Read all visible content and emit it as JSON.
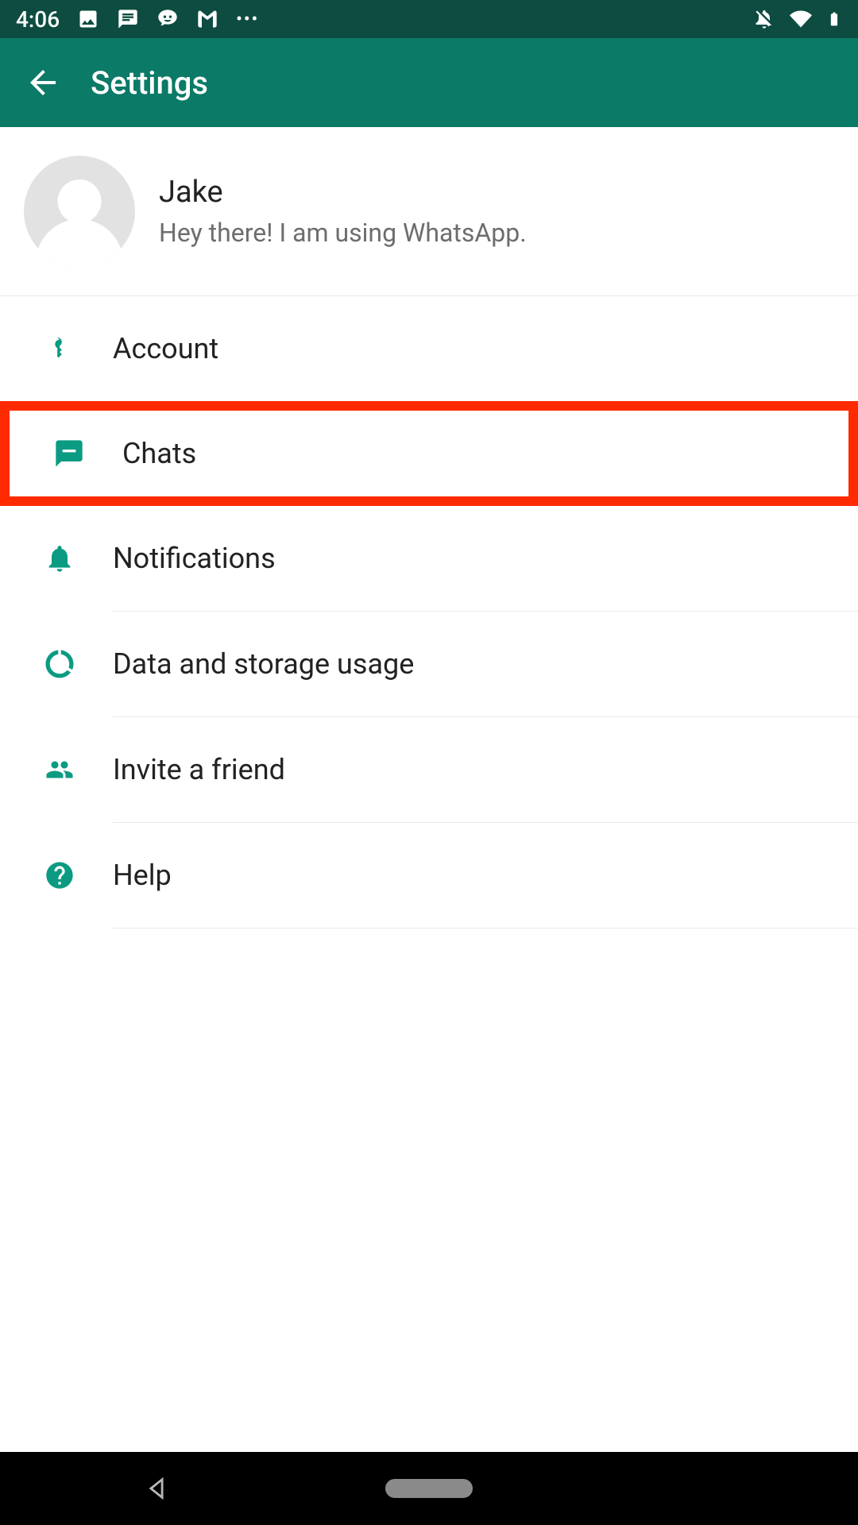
{
  "status": {
    "time": "4:06",
    "dots": "•••"
  },
  "appbar": {
    "title": "Settings"
  },
  "profile": {
    "name": "Jake",
    "status": "Hey there! I am using WhatsApp."
  },
  "menu": {
    "account": "Account",
    "chats": "Chats",
    "notifications": "Notifications",
    "data": "Data and storage usage",
    "invite": "Invite a friend",
    "help": "Help"
  },
  "colors": {
    "brand": "#0b7a66",
    "accent": "#0b9b82",
    "highlight": "#ff2a00"
  }
}
